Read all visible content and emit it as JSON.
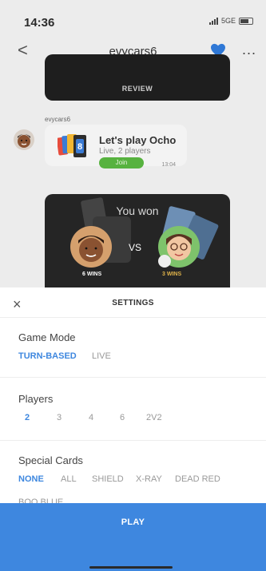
{
  "status": {
    "time": "14:36",
    "network": "5GE"
  },
  "nav": {
    "title": "evycars6",
    "back_glyph": "<",
    "more_glyph": "..."
  },
  "chat": {
    "review_label": "REVIEW",
    "sender": "evycars6",
    "invite": {
      "title": "Let's play Ocho",
      "subtitle": "Live, 2 players",
      "join_label": "Join",
      "time": "13:04",
      "card_digit": "8"
    },
    "result": {
      "title": "You won",
      "vs": "VS",
      "left_wins": "6 WINS",
      "right_wins": "3 WINS"
    }
  },
  "settings": {
    "title": "SETTINGS",
    "close_glyph": "×",
    "game_mode": {
      "label": "Game Mode",
      "options": [
        "TURN-BASED",
        "LIVE"
      ],
      "selected": "TURN-BASED"
    },
    "players": {
      "label": "Players",
      "options": [
        "2",
        "3",
        "4",
        "6",
        "2V2"
      ],
      "selected": "2"
    },
    "special_cards": {
      "label": "Special Cards",
      "options": [
        "NONE",
        "ALL",
        "SHIELD",
        "X-RAY",
        "DEAD RED",
        "BOO BLUE"
      ],
      "selected": "NONE"
    },
    "play_label": "PLAY"
  },
  "colors": {
    "accent": "#3e87df",
    "heart": "#2f78d6",
    "join_green": "#57b23f"
  },
  "icons": [
    "back-chevron-icon",
    "heart-icon",
    "more-icon",
    "close-icon"
  ]
}
